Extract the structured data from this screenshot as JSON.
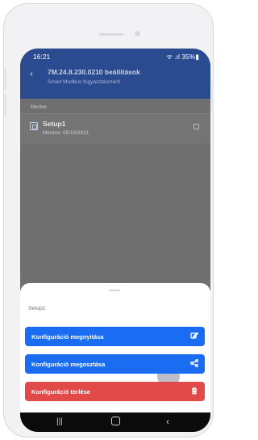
{
  "status_bar": {
    "time": "16:21",
    "right_icons": "ᯤ .ıl 35%▮"
  },
  "app_bar": {
    "back_glyph": "‹",
    "title": "7M.24.8.230.0210 beállítások",
    "subtitle": "Smart Modbus fogyasztásmérő"
  },
  "list": {
    "section_label": "Mentve",
    "items": [
      {
        "name": "Setup1",
        "saved": "Mentve: 05/10/2021"
      }
    ]
  },
  "bottom_sheet": {
    "title": "Setup1",
    "actions": [
      {
        "label": "Konfiguráció megnyitása",
        "icon": "edit-icon",
        "color": "#1a6cf2"
      },
      {
        "label": "Konfiguráció megosztása",
        "icon": "share-icon",
        "color": "#1a6cf2"
      },
      {
        "label": "Konfiguráció törlése",
        "icon": "trash-icon",
        "color": "#e24a4a"
      }
    ]
  },
  "nav_bar": {
    "recent_glyph": "|||",
    "back_glyph": "‹"
  }
}
